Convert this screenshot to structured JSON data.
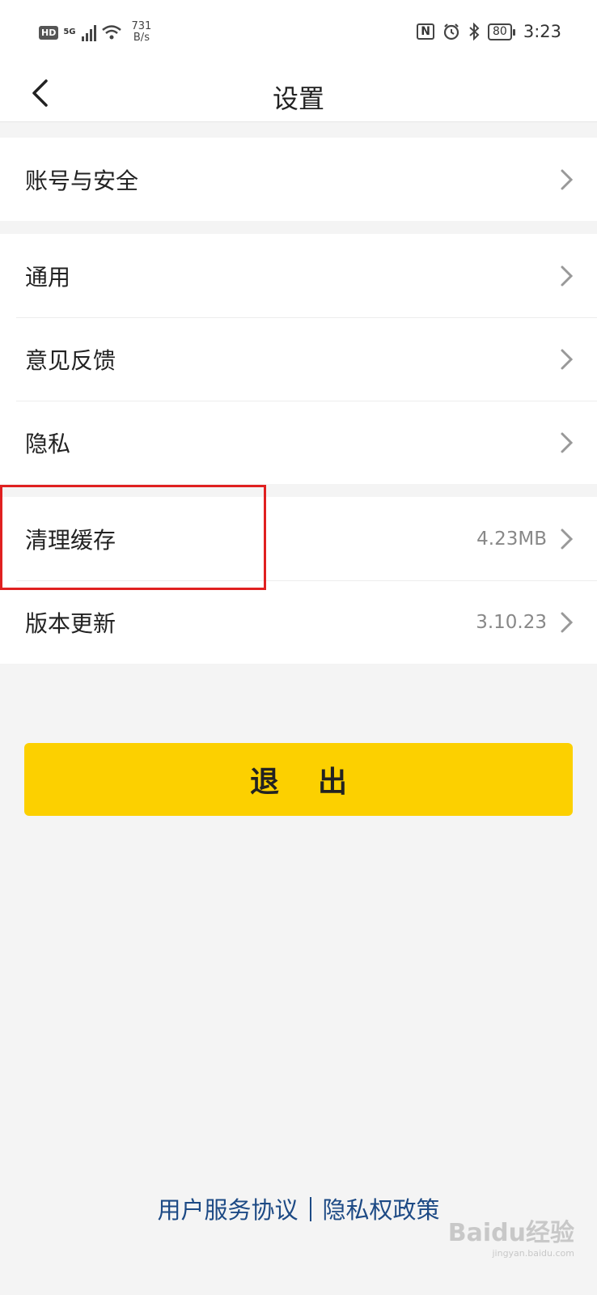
{
  "status_bar": {
    "hd": "HD",
    "network": "5G",
    "speed_value": "731",
    "speed_unit": "B/s",
    "nfc": "N",
    "battery": "80",
    "time": "3:23"
  },
  "header": {
    "title": "设置"
  },
  "groups": [
    {
      "items": [
        {
          "label": "账号与安全",
          "value": ""
        }
      ]
    },
    {
      "items": [
        {
          "label": "通用",
          "value": ""
        },
        {
          "label": "意见反馈",
          "value": ""
        },
        {
          "label": "隐私",
          "value": ""
        }
      ]
    },
    {
      "items": [
        {
          "label": "清理缓存",
          "value": "4.23MB"
        },
        {
          "label": "版本更新",
          "value": "3.10.23"
        }
      ]
    }
  ],
  "logout_label": "退出",
  "footer": {
    "agreement": "用户服务协议",
    "privacy_policy": "隐私权政策"
  },
  "watermark": {
    "brand": "Baidu经验",
    "domain": "jingyan.baidu.com"
  }
}
